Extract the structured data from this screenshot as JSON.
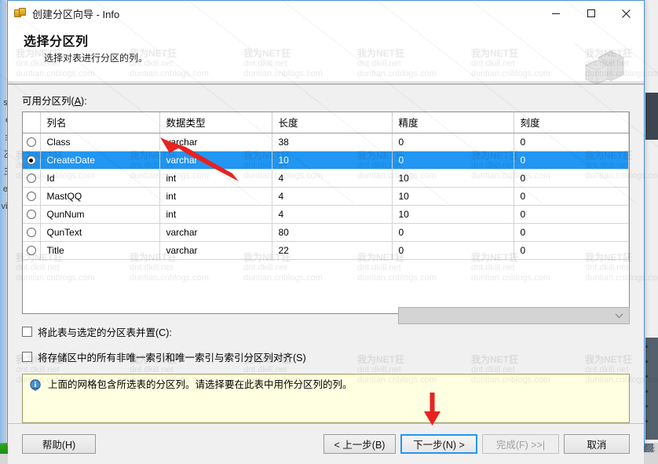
{
  "window": {
    "title": "创建分区向导 - Info",
    "app_icon": "database-wizard-icon",
    "minimize_label": "最小化",
    "maximize_label": "最大化",
    "close_label": "关闭"
  },
  "header": {
    "heading": "选择分区列",
    "subheading": "选择对表进行分区的列。",
    "banner_icon": "database-cubes-icon"
  },
  "main": {
    "grid_label": "可用分区列(A):",
    "grid_label_plain": "可用分区列",
    "grid_label_accel": "A",
    "columns": [
      "列名",
      "数据类型",
      "长度",
      "精度",
      "刻度"
    ],
    "rows": [
      {
        "selected": false,
        "name": "Class",
        "datatype": "varchar",
        "length": "38",
        "precision": "0",
        "scale": "0"
      },
      {
        "selected": true,
        "name": "CreateDate",
        "datatype": "varchar",
        "length": "10",
        "precision": "0",
        "scale": "0"
      },
      {
        "selected": false,
        "name": "Id",
        "datatype": "int",
        "length": "4",
        "precision": "10",
        "scale": "0"
      },
      {
        "selected": false,
        "name": "MastQQ",
        "datatype": "int",
        "length": "4",
        "precision": "10",
        "scale": "0"
      },
      {
        "selected": false,
        "name": "QunNum",
        "datatype": "int",
        "length": "4",
        "precision": "10",
        "scale": "0"
      },
      {
        "selected": false,
        "name": "QunText",
        "datatype": "varchar",
        "length": "80",
        "precision": "0",
        "scale": "0"
      },
      {
        "selected": false,
        "name": "Title",
        "datatype": "varchar",
        "length": "22",
        "precision": "0",
        "scale": "0"
      }
    ],
    "checkbox_colocate": {
      "label": "将此表与选定的分区表并置(C):",
      "checked": false,
      "accel": "C"
    },
    "colocate_combo": {
      "value": "",
      "enabled": false,
      "chevron": "chevron-down-icon"
    },
    "checkbox_align": {
      "label": "将存储区中的所有非唯一索引和唯一索引与索引分区列对齐(S)",
      "checked": false,
      "accel": "S"
    },
    "info": {
      "icon": "info-icon",
      "text": "上面的网格包含所选表的分区列。请选择要在此表中用作分区列的列。"
    }
  },
  "footer": {
    "help": "帮助(H)",
    "back": "< 上一步(B)",
    "next": "下一步(N) >",
    "finish": "完成(F) >>|",
    "cancel": "取消",
    "finish_enabled": false,
    "next_is_default": true
  },
  "watermark": {
    "line1": "我为NET狂",
    "line2": "dnt.dkill.net",
    "line3": "duntian.cnblogs.com"
  },
  "annotations": {
    "arrow_grid": "red-arrow-pointing-to-selected-datatype",
    "arrow_next": "red-arrow-pointing-to-next-button"
  },
  "background": {
    "left_edge_text": "se e ョ 乙 三 e f vi b  l",
    "colors": {
      "accent": "#2196f3",
      "selection": "#2196f3",
      "info_bg": "#ffffe1",
      "taskbar_green": "#2faa22",
      "annotation_red": "#e8221f"
    }
  }
}
